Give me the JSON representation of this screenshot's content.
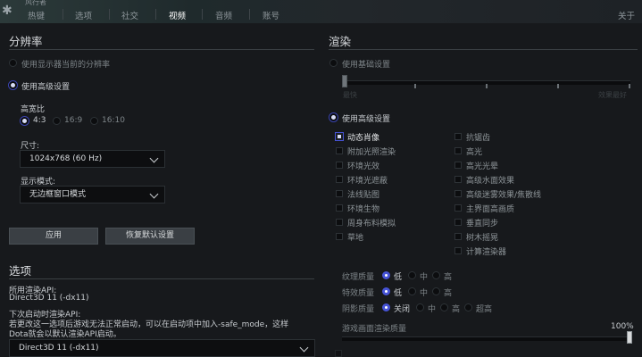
{
  "topbar": {
    "subtitle": "风行者",
    "tabs": [
      "热键",
      "选项",
      "社交",
      "视频",
      "音频",
      "账号"
    ],
    "active_tab": "视频",
    "about": "关于"
  },
  "resolution": {
    "title": "分辨率",
    "use_monitor": "使用显示器当前的分辨率",
    "use_advanced": "使用高级设置",
    "aspect_label": "高宽比",
    "aspects": [
      "4:3",
      "16:9",
      "16:10"
    ],
    "selected_aspect": "4:3",
    "size_label": "尺寸:",
    "size_value": "1024x768 (60 Hz)",
    "display_mode_label": "显示模式:",
    "display_mode_value": "无边框窗口模式",
    "apply": "应用",
    "restore": "恢复默认设置"
  },
  "options": {
    "title": "选项",
    "api_label": "所用渲染API:",
    "api_value": "Direct3D 11 (-dx11)",
    "next_label": "下次启动时渲染API:",
    "note_line1": "若更改这一选项后游戏无法正常启动，可以在启动项中加入-safe_mode，这样",
    "note_line2": "Dota就会以默认渲染API启动。",
    "api_select": "Direct3D 11 (-dx11)"
  },
  "rendering": {
    "title": "渲染",
    "use_basic": "使用基础设置",
    "basic_left": "最快",
    "basic_right": "效果最好",
    "use_advanced": "使用高级设置",
    "checks_left": [
      {
        "label": "动态肖像",
        "on": true
      },
      {
        "label": "附加光照渲染",
        "on": false
      },
      {
        "label": "环境光效",
        "on": false
      },
      {
        "label": "环境光遮蔽",
        "on": false
      },
      {
        "label": "法线贴图",
        "on": false
      },
      {
        "label": "环境生物",
        "on": false
      },
      {
        "label": "周身布料模拟",
        "on": false
      },
      {
        "label": "草地",
        "on": false
      }
    ],
    "checks_right": [
      {
        "label": "抗锯齿",
        "on": false
      },
      {
        "label": "高光",
        "on": false
      },
      {
        "label": "高光光晕",
        "on": false
      },
      {
        "label": "高级水面效果",
        "on": false
      },
      {
        "label": "高级迷雾效果/焦散线",
        "on": false
      },
      {
        "label": "主界面高画质",
        "on": false
      },
      {
        "label": "垂直同步",
        "on": false
      },
      {
        "label": "树木摇晃",
        "on": false
      },
      {
        "label": "计算渲染器",
        "on": false
      }
    ],
    "texture_label": "纹理质量",
    "effects_label": "特效质量",
    "shadow_label": "阴影质量",
    "low": "低",
    "mid": "中",
    "high": "高",
    "off": "关闭",
    "ultra": "超高",
    "render_quality_label": "游戏画面渲染质量",
    "render_quality_value": "100%",
    "render_quality_fraction": 1.0
  }
}
